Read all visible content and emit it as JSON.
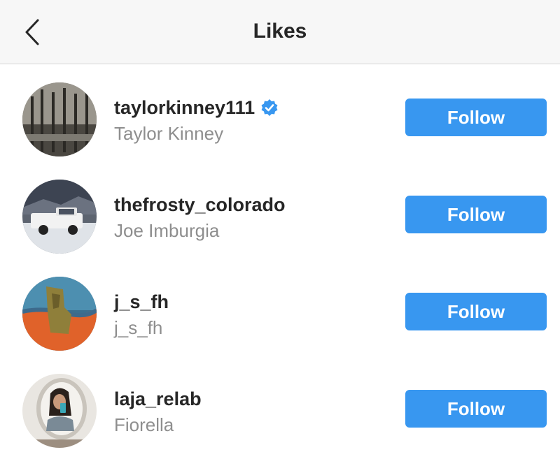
{
  "header": {
    "title": "Likes",
    "back_icon": "chevron-left-icon"
  },
  "colors": {
    "accent": "#3897f0",
    "username": "#262626",
    "fullname": "#8e8e8e",
    "header_bg": "#f7f7f7",
    "verified_badge": "#3897f0"
  },
  "likes": [
    {
      "username": "taylorkinney111",
      "full_name": "Taylor Kinney",
      "verified": true,
      "button_label": "Follow",
      "avatar_icon": "forest-photo-avatar"
    },
    {
      "username": "thefrosty_colorado",
      "full_name": "Joe Imburgia",
      "verified": false,
      "button_label": "Follow",
      "avatar_icon": "white-truck-photo-avatar"
    },
    {
      "username": "j_s_fh",
      "full_name": "j_s_fh",
      "verified": false,
      "button_label": "Follow",
      "avatar_icon": "painting-photo-avatar"
    },
    {
      "username": "laja_relab",
      "full_name": "Fiorella",
      "verified": false,
      "button_label": "Follow",
      "avatar_icon": "mirror-selfie-photo-avatar"
    }
  ]
}
